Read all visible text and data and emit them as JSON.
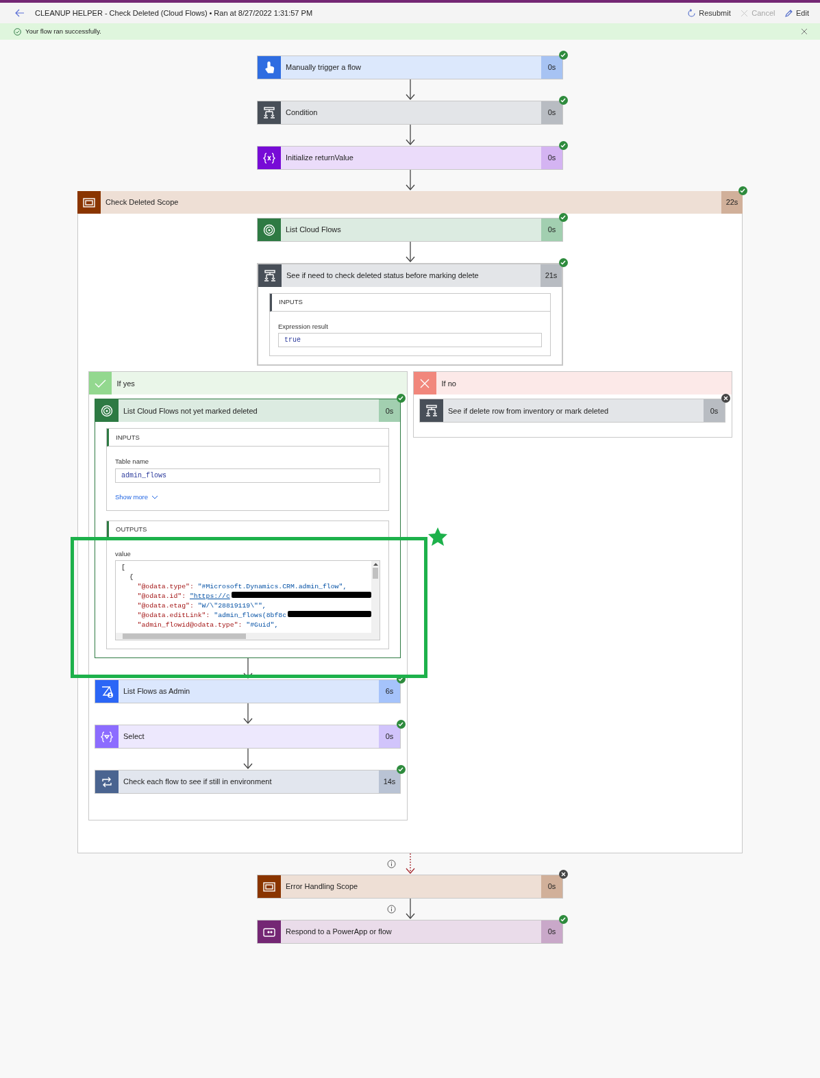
{
  "header": {
    "title": "CLEANUP HELPER - Check Deleted (Cloud Flows)",
    "run_info": "• Ran at 8/27/2022 1:31:57 PM",
    "actions": [
      {
        "kind": "resubmit",
        "label": "Resubmit",
        "disabled": false
      },
      {
        "kind": "cancel",
        "label": "Cancel",
        "disabled": true
      },
      {
        "kind": "edit",
        "label": "Edit",
        "disabled": false
      }
    ]
  },
  "banner": {
    "message": "Your flow ran successfully."
  },
  "flow": [
    {
      "kind": "trigger",
      "title": "Manually trigger a flow",
      "duration": "0s",
      "skipped": false,
      "arrow": false,
      "info": false,
      "expanded": false
    },
    {
      "kind": "condition",
      "title": "Condition",
      "duration": "0s",
      "skipped": false,
      "arrow": true,
      "dashed": false,
      "info": false,
      "expanded": false
    },
    {
      "kind": "variable",
      "title": "Initialize returnValue",
      "duration": "0s",
      "skipped": false,
      "arrow": true,
      "dashed": false,
      "info": false,
      "expanded": false
    },
    {
      "kind": "scope",
      "title": "Check Deleted Scope",
      "duration": "22s",
      "skipped": false,
      "arrow": true,
      "dashed": false,
      "info": false,
      "children": [
        {
          "kind": "dataverse",
          "title": "List Cloud Flows",
          "duration": "0s",
          "skipped": false,
          "arrow": false,
          "info": false,
          "expanded": false
        },
        {
          "kind": "condition",
          "title": "See if need to check deleted status before marking delete",
          "duration": "21s",
          "skipped": false,
          "arrow": true,
          "dashed": false,
          "info": false,
          "expanded": true,
          "details": [
            {
              "heading": "INPUTS",
              "fields": [
                {
                  "label": "Expression result",
                  "value": "true"
                }
              ]
            }
          ]
        },
        {
          "kind": "branches",
          "branches": [
            {
              "kind": "yes",
              "label": "If yes",
              "children": [
                {
                  "kind": "dataverse",
                  "title": "List Cloud Flows not yet marked deleted",
                  "duration": "0s",
                  "skipped": false,
                  "arrow": false,
                  "info": false,
                  "expanded": true,
                  "details": [
                    {
                      "heading": "INPUTS",
                      "fields": [
                        {
                          "label": "Table name",
                          "value": "admin_flows"
                        }
                      ],
                      "show_more": "Show more"
                    },
                    {
                      "heading": "OUTPUTS",
                      "fields": [
                        {
                          "label": "value",
                          "code": {
                            "open": "[",
                            "objects": [
                              {
                                "open": "{",
                                "pairs": [
                                  {
                                    "key": "\"@odata.type\":",
                                    "value": "\"#Microsoft.Dynamics.CRM.admin_flow\",",
                                    "link": false,
                                    "redacted": false
                                  },
                                  {
                                    "key": "\"@odata.id\":",
                                    "value": "\"https://c",
                                    "link": true,
                                    "redacted": true
                                  },
                                  {
                                    "key": "\"@odata.etag\":",
                                    "value": "\"W/\\\"28819119\\\"\",",
                                    "link": false,
                                    "redacted": false
                                  },
                                  {
                                    "key": "\"@odata.editLink\":",
                                    "value": "\"admin_flows(8bf8c",
                                    "link": false,
                                    "redacted": true
                                  },
                                  {
                                    "key": "\"admin_flowid@odata.type\":",
                                    "value": "\"#Guid\",",
                                    "link": false,
                                    "redacted": false
                                  }
                                ]
                              }
                            ]
                          }
                        }
                      ]
                    }
                  ]
                },
                {
                  "kind": "admin",
                  "title": "List Flows as Admin",
                  "duration": "6s",
                  "skipped": false,
                  "arrow": true,
                  "dashed": false,
                  "info": false,
                  "expanded": false
                },
                {
                  "kind": "select",
                  "title": "Select",
                  "duration": "0s",
                  "skipped": false,
                  "arrow": true,
                  "dashed": false,
                  "info": false,
                  "expanded": false
                },
                {
                  "kind": "loop",
                  "title": "Check each flow to see if still in environment",
                  "duration": "14s",
                  "skipped": false,
                  "arrow": true,
                  "dashed": false,
                  "info": false,
                  "expanded": false
                }
              ]
            },
            {
              "kind": "no",
              "label": "If no",
              "children": [
                {
                  "kind": "condition",
                  "title": "See if delete row from inventory or mark deleted",
                  "duration": "0s",
                  "skipped": true,
                  "arrow": false,
                  "info": false,
                  "expanded": false
                }
              ]
            }
          ]
        }
      ]
    },
    {
      "kind": "scope",
      "title": "Error Handling Scope",
      "duration": "0s",
      "skipped": true,
      "arrow": true,
      "dashed": true,
      "info": true,
      "expanded": false
    },
    {
      "kind": "powerapps",
      "title": "Respond to a PowerApp or flow",
      "duration": "0s",
      "skipped": false,
      "arrow": true,
      "dashed": false,
      "info": true,
      "expanded": false
    }
  ]
}
